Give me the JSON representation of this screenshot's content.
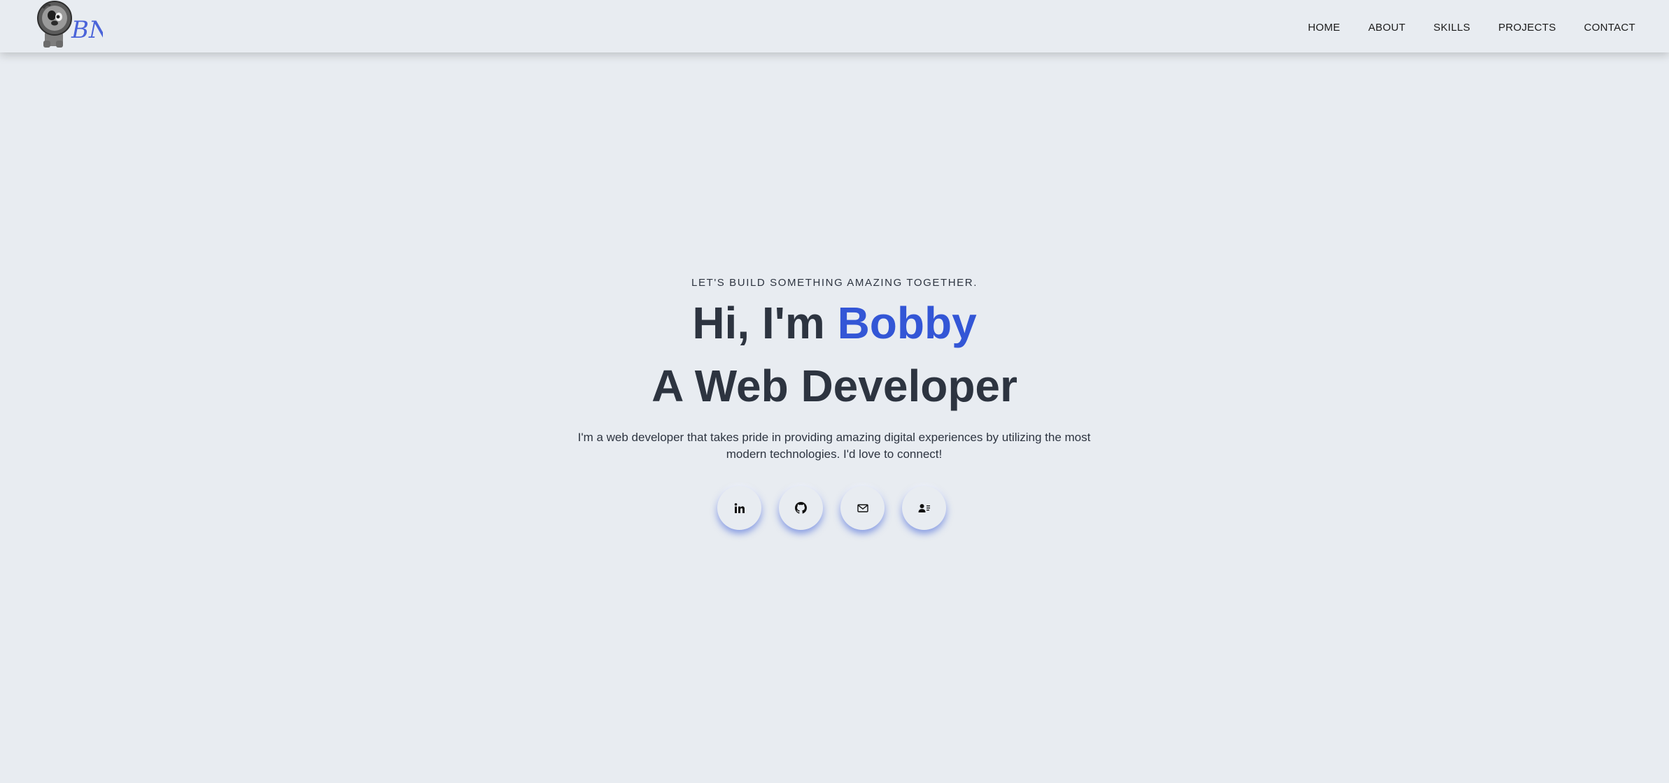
{
  "header": {
    "logo_text": "BN",
    "nav": [
      "HOME",
      "ABOUT",
      "SKILLS",
      "PROJECTS",
      "CONTACT"
    ]
  },
  "hero": {
    "tagline": "LET'S BUILD SOMETHING AMAZING TOGETHER.",
    "greeting": "Hi, I'm ",
    "name": "Bobby",
    "subtitle": "A Web Developer",
    "intro": "I'm a web developer that takes pride in providing amazing digital experiences by utilizing the most modern technologies. I'd love to connect!",
    "socials": [
      {
        "icon": "linkedin-icon"
      },
      {
        "icon": "github-icon"
      },
      {
        "icon": "mail-icon"
      },
      {
        "icon": "contact-card-icon"
      }
    ]
  },
  "colors": {
    "background": "#e8ecf1",
    "accent": "#3356d6",
    "heading": "#2d3440"
  }
}
